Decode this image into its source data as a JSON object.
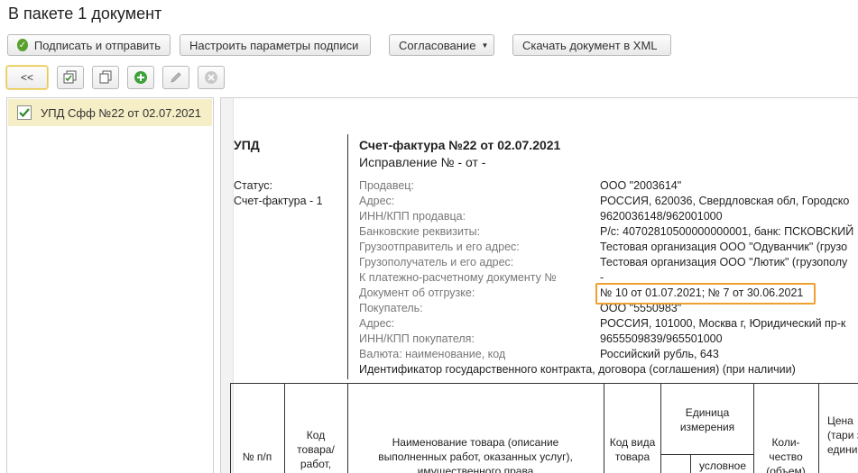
{
  "window": {
    "title": "В пакете 1 документ"
  },
  "toolbar": {
    "sign_send": "Подписать и отправить",
    "sign_params": "Настроить параметры подписи",
    "approval": "Согласование",
    "download_xml": "Скачать документ в XML",
    "back": "<<"
  },
  "icons": {
    "sign_send": "green-check-circle-icon",
    "select_all": "select-all-icon",
    "copy": "copy-icon",
    "add": "green-plus-icon",
    "edit": "pencil-icon",
    "delete": "grey-cross-circle-icon"
  },
  "document_list": [
    {
      "label": "УПД Сфф №22 от 02.07.2021",
      "checked": true
    }
  ],
  "doc": {
    "type": "УПД",
    "status_label": "Статус:",
    "status_value": "Счет-фактура - 1",
    "heading": "Счет-фактура №22 от 02.07.2021",
    "correction": "Исправление № - от -",
    "fields": [
      {
        "label": "Продавец:",
        "value": "ООО \"2003614\""
      },
      {
        "label": "Адрес:",
        "value": "РОССИЯ, 620036, Свердловская обл, Городско"
      },
      {
        "label": "ИНН/КПП продавца:",
        "value": "9620036148/962001000"
      },
      {
        "label": "Банковские реквизиты:",
        "value": "Р/с: 40702810500000000001, банк: ПСКОВСКИЙ"
      },
      {
        "label": "Грузоотправитель и его адрес:",
        "value": "Тестовая организация ООО \"Одуванчик\" (грузо"
      },
      {
        "label": "Грузополучатель и его адрес:",
        "value": "Тестовая организация ООО \"Лютик\" (грузополу"
      },
      {
        "label": "К платежно-расчетному документу №",
        "value": "-"
      },
      {
        "label": "Документ об отгрузке:",
        "value": "№ 10 от 01.07.2021; № 7 от 30.06.2021"
      },
      {
        "label": "Покупатель:",
        "value": "ООО \"5550983\""
      },
      {
        "label": "Адрес:",
        "value": "РОССИЯ, 101000, Москва г, Юридический пр-к"
      },
      {
        "label": "ИНН/КПП покупателя:",
        "value": "9655509839/965501000"
      },
      {
        "label": "Валюта: наименование, код",
        "value": "Российский рубль, 643"
      }
    ],
    "contract_id": "Идентификатор государственного контракта, договора (соглашения) (при наличии)",
    "table_headers": {
      "num": "№ п/п",
      "code": "Код товара/ работ,",
      "name": "Наименование товара (описание выполненных работ, оказанных услуг), имущественного права",
      "kind": "Код вида товара",
      "unit": "Единица измерения",
      "unit_sub": "условное",
      "qty": "Коли- чество (объем)",
      "price": "Цена (тари за едини"
    }
  },
  "colors": {
    "highlight": "#f0a030",
    "selected_row": "#f6eec6"
  }
}
